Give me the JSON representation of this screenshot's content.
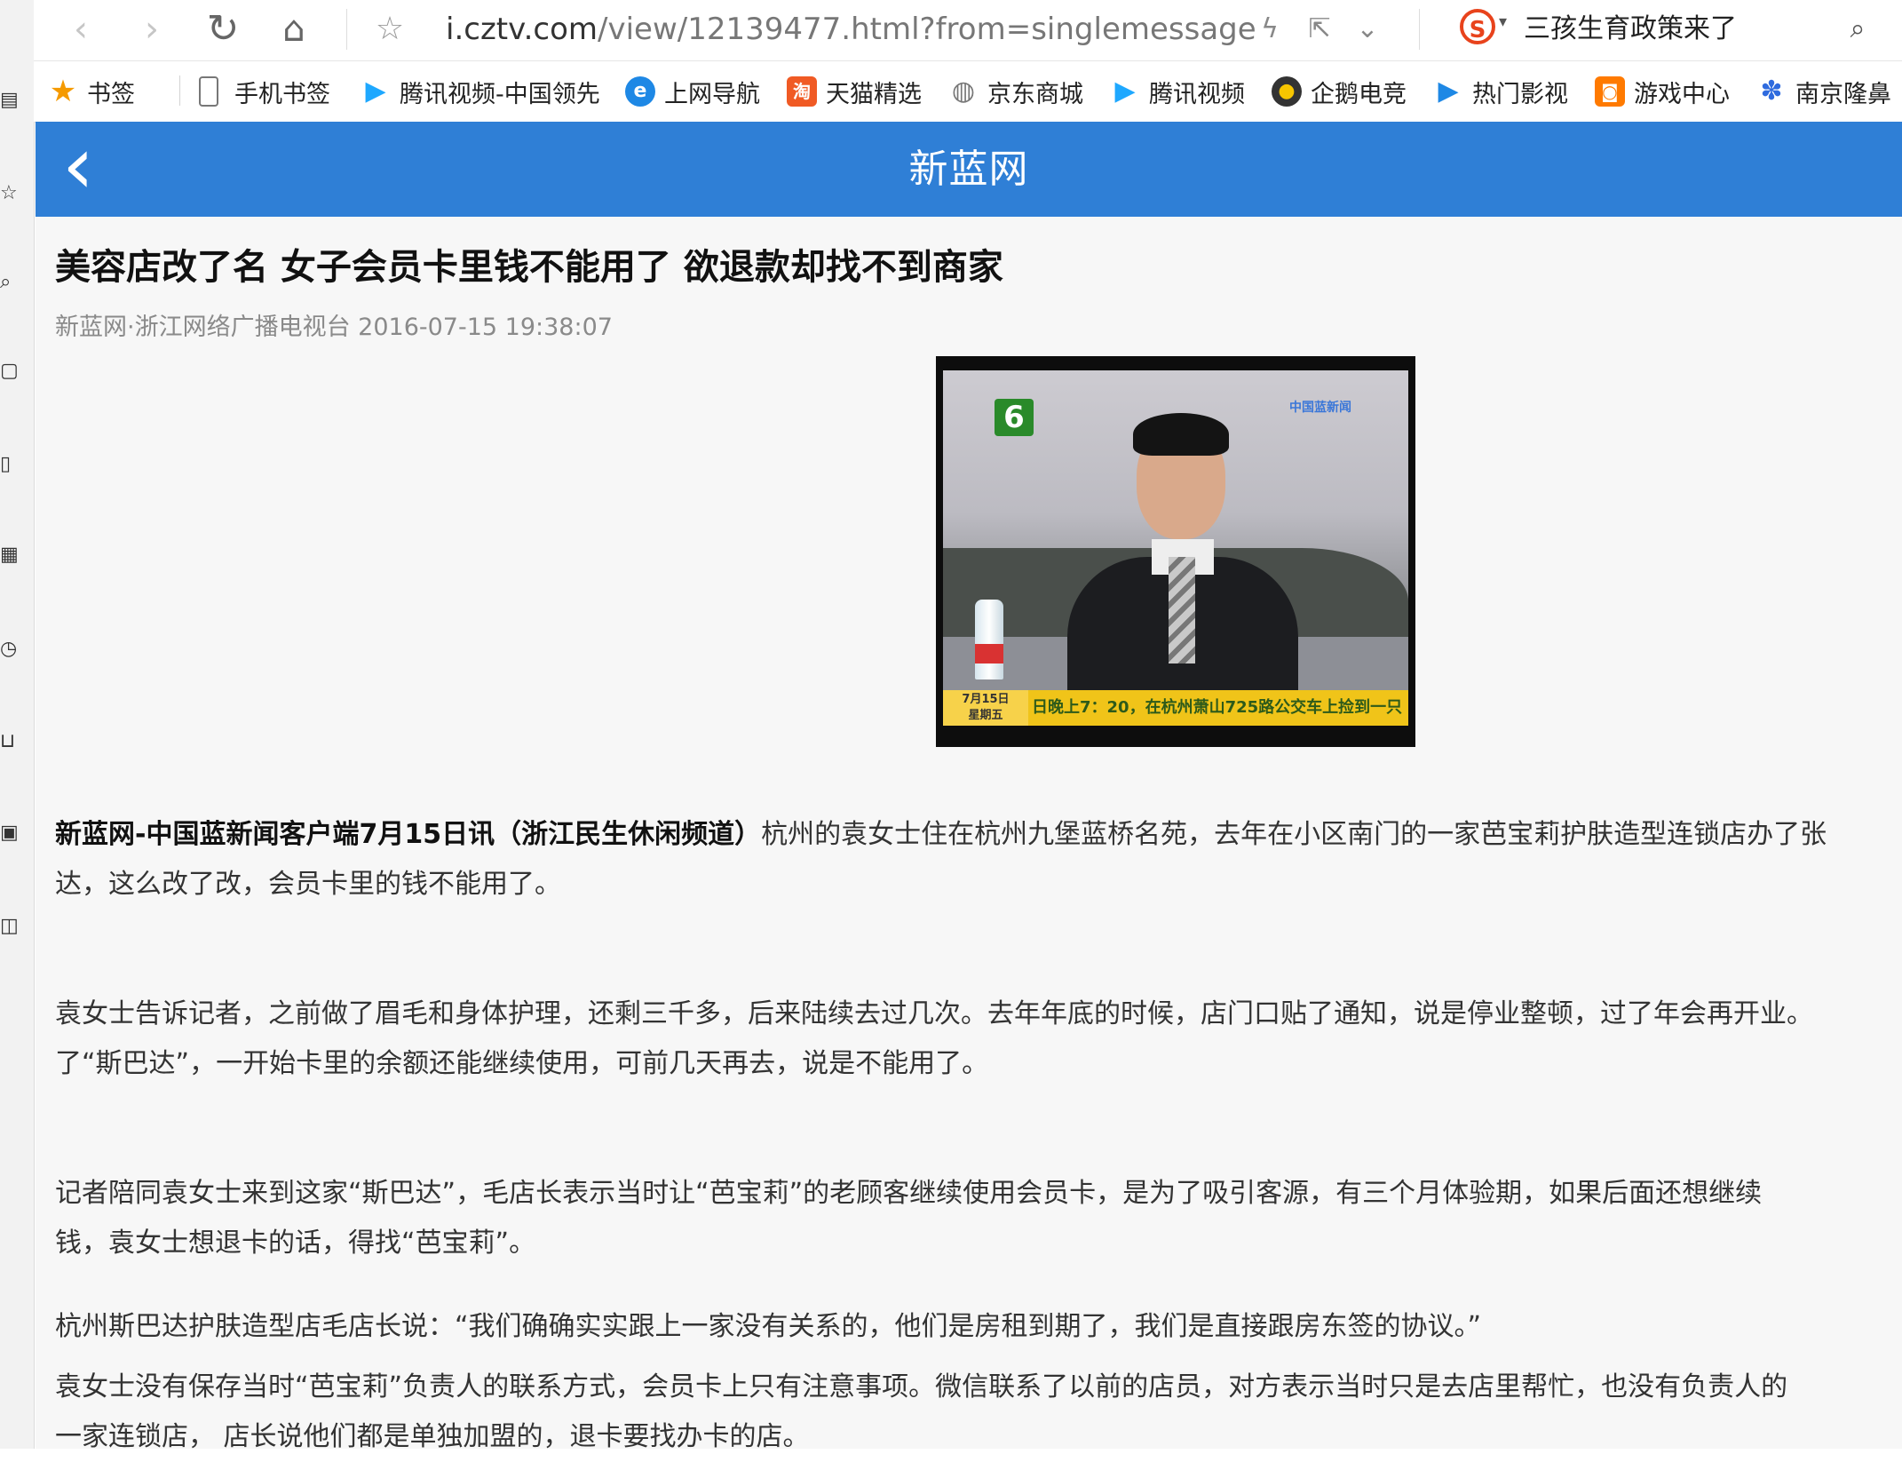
{
  "browser": {
    "url_host": "i.cztv.com",
    "url_path": "/view/12139477.html?from=singlemessage",
    "search_placeholder": "三孩生育政策来了"
  },
  "bookmarks": [
    {
      "label": "书签",
      "icon": "star-icon",
      "color": "#f59a00"
    },
    {
      "label": "手机书签",
      "icon": "mobile-icon",
      "color": "#666666"
    },
    {
      "label": "腾讯视频-中国领先",
      "icon": "play-icon",
      "color": "#1ea8ff"
    },
    {
      "label": "上网导航",
      "icon": "ie-icon",
      "color": "#1e88e5"
    },
    {
      "label": "天猫精选",
      "icon": "tmall-icon",
      "color": "#f05a24"
    },
    {
      "label": "京东商城",
      "icon": "globe-icon",
      "color": "#777777"
    },
    {
      "label": "腾讯视频",
      "icon": "play-icon",
      "color": "#1ea8ff"
    },
    {
      "label": "企鹅电竞",
      "icon": "penguin-icon",
      "color": "#333333"
    },
    {
      "label": "热门影视",
      "icon": "film-icon",
      "color": "#1e88e5"
    },
    {
      "label": "游戏中心",
      "icon": "gamepad-icon",
      "color": "#ff7a00"
    },
    {
      "label": "南京隆鼻",
      "icon": "baidu-icon",
      "color": "#2f6bde"
    }
  ],
  "site": {
    "title": "新蓝网",
    "header_color": "#2f7fd6"
  },
  "article": {
    "headline": "美容店改了名 女子会员卡里钱不能用了 欲退款却找不到商家",
    "meta": "新蓝网·浙江网络广播电视台 2016-07-15 19:38:07",
    "video": {
      "channel_number": "6",
      "channel_logo": "中国蓝新闻",
      "ticker_date_1": "7月15日",
      "ticker_date_2": "星期五",
      "ticker_text": "日晚上7：20，在杭州萧山725路公交车上捡到一只"
    },
    "p1_lead": "新蓝网-中国蓝新闻客户端7月15日讯（浙江民生休闲频道）",
    "p1_line1": "杭州的袁女士住在杭州九堡蓝桥名苑，去年在小区南门的一家芭宝莉护肤造型连锁店办了张",
    "p1_line2": "达，这么改了改，会员卡里的钱不能用了。",
    "p2_line1": "袁女士告诉记者，之前做了眉毛和身体护理，还剩三千多，后来陆续去过几次。去年年底的时候，店门口贴了通知，说是停业整顿，过了年会再开业。",
    "p2_line2": "了“斯巴达”，一开始卡里的余额还能继续使用，可前几天再去，说是不能用了。",
    "p3_line1": "记者陪同袁女士来到这家“斯巴达”，毛店长表示当时让“芭宝莉”的老顾客继续使用会员卡，是为了吸引客源，有三个月体验期，如果后面还想继续",
    "p3_line2": "钱，袁女士想退卡的话，得找“芭宝莉”。",
    "p4_line1": "杭州斯巴达护肤造型店毛店长说：“我们确确实实跟上一家没有关系的，他们是房租到期了，我们是直接跟房东签的协议。”",
    "p5_line1": "袁女士没有保存当时“芭宝莉”负责人的联系方式，会员卡上只有注意事项。微信联系了以前的店员，对方表示当时只是去店里帮忙，也没有负责人的",
    "p5_line2": "一家连锁店， 店长说他们都是单独加盟的，退卡要找办卡的店。"
  }
}
